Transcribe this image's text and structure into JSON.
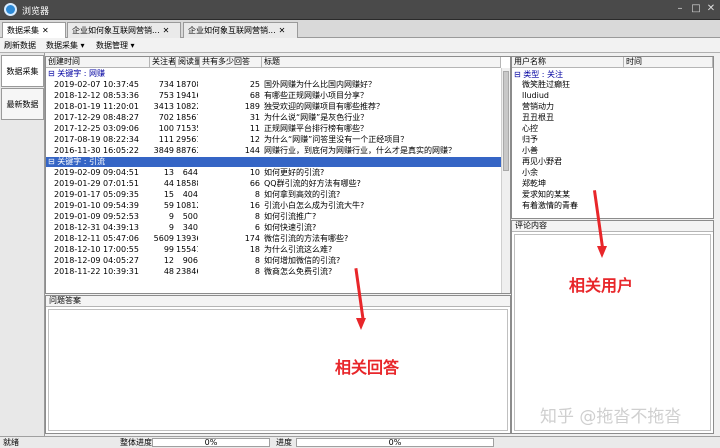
{
  "window": {
    "title": "浏览器"
  },
  "tabs": [
    {
      "label": "数据采集",
      "close": "✕"
    },
    {
      "label": "企业如何象互联网营销...",
      "close": "✕"
    },
    {
      "label": "企业如何象互联网营销...",
      "close": "✕"
    }
  ],
  "menu": {
    "refresh": "刷新数据",
    "collect": "数据采集 ▾",
    "manage": "数据管理 ▾"
  },
  "leftnav": {
    "collect": "数据采集",
    "latest": "最新数据"
  },
  "grid": {
    "headers": [
      "创建时间",
      "关注者",
      "阅读量",
      "共有多少回答",
      "标题"
    ],
    "groups": [
      {
        "label": "⊟ 关键字 : 网赚",
        "rows": [
          [
            "2019-02-07 10:37:45",
            "734",
            "18708",
            "25",
            "国外网赚为什么比国内网赚好？"
          ],
          [
            "2018-12-12 08:53:36",
            "753",
            "19416",
            "68",
            "有哪些正规网赚小项目分享？"
          ],
          [
            "2018-01-19 11:20:01",
            "3413",
            "108227",
            "189",
            "独受欢迎的网赚项目有哪些推荐？"
          ],
          [
            "2017-12-29 08:48:27",
            "702",
            "18567",
            "31",
            "为什么说“网赚”是灰色行业？"
          ],
          [
            "2017-12-25 03:09:06",
            "100",
            "71535",
            "11",
            "正规网赚平台排行榜有哪些？"
          ],
          [
            "2017-08-19 08:22:34",
            "111",
            "29561",
            "12",
            "为什么“网赚”问答里没有一个正经项目？"
          ],
          [
            "2016-11-30 16:05:22",
            "3849",
            "887630",
            "144",
            "网赚行业，到底何为网赚行业，什么才是真实的网赚？"
          ]
        ]
      },
      {
        "label": "⊟ 关键字 : 引流",
        "rows": [
          [
            "2019-02-09 09:04:51",
            "13",
            "644",
            "10",
            "如何更好的引流?"
          ],
          [
            "2019-01-29 07:01:51",
            "44",
            "18588",
            "66",
            "QQ群引流的好方法有哪些?"
          ],
          [
            "2019-01-17 05:09:35",
            "15",
            "404",
            "8",
            "如何拿到高效的引流?"
          ],
          [
            "2019-01-10 09:54:39",
            "59",
            "10812",
            "16",
            "引流小白怎么成为引流大牛?"
          ],
          [
            "2019-01-09 09:52:53",
            "9",
            "500",
            "8",
            "如何引流推广?"
          ],
          [
            "2018-12-31 04:39:13",
            "9",
            "340",
            "6",
            "如何快速引流?"
          ],
          [
            "2018-12-11 05:47:06",
            "5609",
            "13936",
            "174",
            "微信引流的方法有哪些?"
          ],
          [
            "2018-12-10 17:00:55",
            "99",
            "15541",
            "18",
            "为什么引流这么难?"
          ],
          [
            "2018-12-09 04:05:27",
            "12",
            "906",
            "8",
            "如何增加微信的引流?"
          ],
          [
            "2018-11-22 10:39:31",
            "48",
            "23846",
            "8",
            "微商怎么免费引流?"
          ]
        ]
      }
    ]
  },
  "answers": {
    "caption": "问题答案"
  },
  "users": {
    "headers": [
      "用户名称",
      "时间"
    ],
    "group": "⊟ 类型 : 关注",
    "items": [
      "微笑胜过癫狂",
      "lludiud",
      "营销动力",
      "丑丑根丑",
      "心控",
      "归予",
      "小善",
      "再见小野君",
      "小余",
      "郑乾坤",
      "爱求知的某某",
      "有着激情的青春"
    ]
  },
  "comments": {
    "caption": "评论内容"
  },
  "annotations": {
    "answers_label": "相关回答",
    "users_label": "相关用户"
  },
  "statusbar": {
    "ready": "就绪",
    "overall": "整体进度",
    "overall_value": "0%",
    "progress": "进度",
    "progress_value": "0%"
  },
  "watermark": "知乎 @拖沓不拖沓",
  "colors": {
    "selection": "#3565c5",
    "annotation": "#e8262a",
    "titlebar": "#4a4a4a"
  }
}
